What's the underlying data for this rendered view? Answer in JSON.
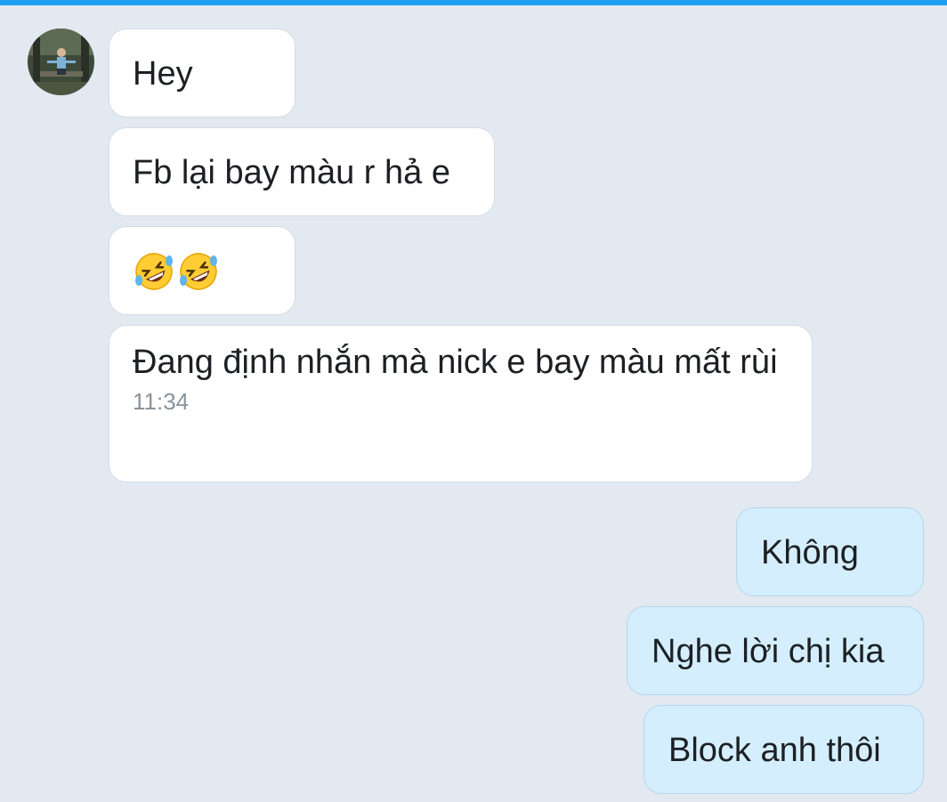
{
  "colors": {
    "background": "#e2e9f1",
    "accent_bar": "#1ea0f2",
    "incoming_bubble": "#ffffff",
    "outgoing_bubble": "#d4eefd",
    "text": "#1c2024",
    "timestamp": "#8a939c"
  },
  "contact": {
    "avatar_icon": "avatar-photo"
  },
  "messages": {
    "incoming": [
      {
        "text": "Hey"
      },
      {
        "text": "Fb lại bay màu r hả e"
      },
      {
        "emoji": [
          "rolling-on-floor-laughing",
          "rolling-on-floor-laughing"
        ]
      },
      {
        "text": "Đang định nhắn mà nick e bay màu mất rùi",
        "time": "11:34"
      }
    ],
    "outgoing": [
      {
        "text": "Không"
      },
      {
        "text": "Nghe lời chị kia"
      },
      {
        "text": "Block anh thôi"
      }
    ]
  }
}
